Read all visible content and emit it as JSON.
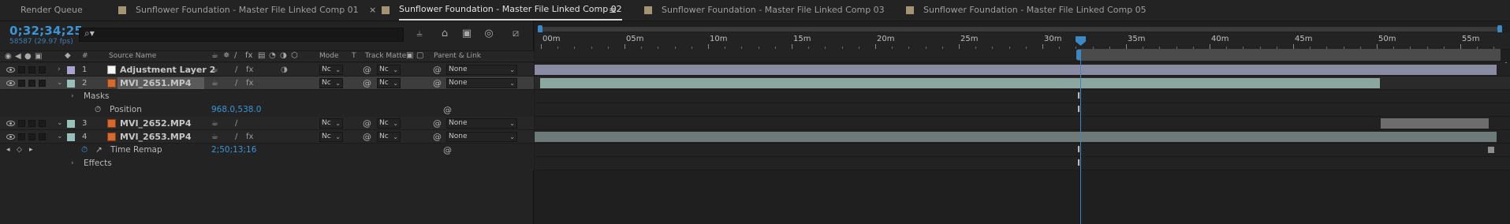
{
  "tabs": [
    {
      "label": "Render Queue",
      "active": false,
      "has_swatch": false
    },
    {
      "label": "Sunflower Foundation - Master File Linked Comp 01",
      "active": false,
      "has_swatch": true
    },
    {
      "label": "Sunflower Foundation - Master File Linked Comp 02",
      "active": true,
      "has_swatch": true
    },
    {
      "label": "Sunflower Foundation - Master File Linked Comp 03",
      "active": false,
      "has_swatch": true
    },
    {
      "label": "Sunflower Foundation - Master File Linked Comp 05",
      "active": false,
      "has_swatch": true
    }
  ],
  "tab_close_glyph": "×",
  "tab_menu_glyph": "≡",
  "timecode": "0;32;34;25",
  "frames": "58587 (29.97 fps)",
  "search": {
    "placeholder": "",
    "icon": "search-icon"
  },
  "columns": {
    "number": "#",
    "source_name": "Source Name",
    "mode": "Mode",
    "t": "T",
    "track_matte": "Track Matte",
    "parent_link": "Parent & Link"
  },
  "layers": [
    {
      "num": "1",
      "name": "Adjustment Layer 2",
      "label_color": "#a9a4cf",
      "type": "adjustment",
      "mode": "Nc",
      "matte": "Nc",
      "parent": "None",
      "selected": false
    },
    {
      "num": "2",
      "name": "MVI_2651.MP4",
      "label_color": "#97c0b8",
      "type": "video",
      "mode": "Nc",
      "matte": "Nc",
      "parent": "None",
      "selected": true
    },
    {
      "num": "3",
      "name": "MVI_2652.MP4",
      "label_color": "#97c0b8",
      "type": "video",
      "mode": "Nc",
      "matte": "Nc",
      "parent": "None",
      "selected": false
    },
    {
      "num": "4",
      "name": "MVI_2653.MP4",
      "label_color": "#97c0b8",
      "type": "video",
      "mode": "Nc",
      "matte": "Nc",
      "parent": "None",
      "selected": false
    }
  ],
  "props": {
    "masks": "Masks",
    "position_label": "Position",
    "position_value": "968.0,538.0",
    "time_remap_label": "Time Remap",
    "time_remap_value": "2;50;13;16",
    "effects": "Effects"
  },
  "ruler": {
    "labels": [
      "00m",
      "05m",
      "10m",
      "15m",
      "20m",
      "25m",
      "30m",
      "35m",
      "40m",
      "45m",
      "50m",
      "55m"
    ]
  },
  "colors": {
    "accent": "#3a88c6",
    "timecode": "#3a95d8",
    "adj_bar": "#8b8aa3",
    "teal_bar": "#8ba7a0",
    "gray_bar": "#6d6d6d"
  }
}
